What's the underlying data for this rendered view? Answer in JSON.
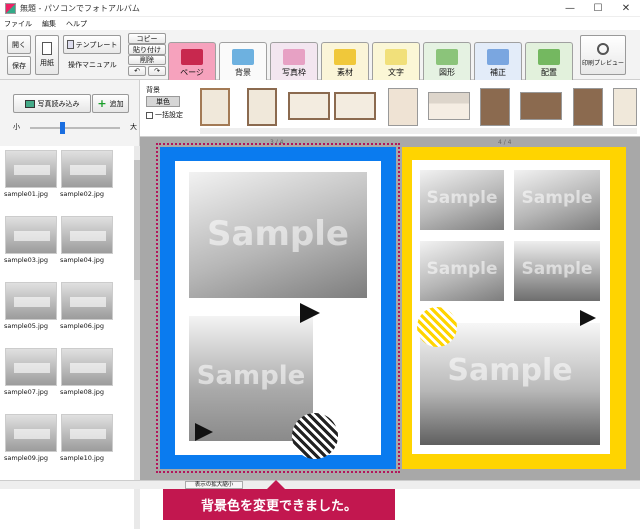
{
  "window": {
    "title": "無題 - パソコンでフォトアルバム",
    "min": "—",
    "max": "☐",
    "close": "✕"
  },
  "menu": [
    "ファイル",
    "編集",
    "ヘルプ"
  ],
  "toolbar": {
    "open": "開く",
    "save": "保存",
    "paper": "用紙",
    "template": "テンプレート",
    "manual": "操作マニュアル",
    "copy": "コピー",
    "paste": "貼り付け",
    "delete": "削除",
    "undo": "↶",
    "redo": "↷",
    "print_preview": "印刷プレビュー"
  },
  "tabs": [
    {
      "label": "ページ",
      "color": "#f08aa8"
    },
    {
      "label": "背景",
      "color": "#f5f5f5"
    },
    {
      "label": "写真枠",
      "color": "#f5f5f5"
    },
    {
      "label": "素材",
      "color": "#f5f5f5"
    },
    {
      "label": "文字",
      "color": "#f5f5f5"
    },
    {
      "label": "図形",
      "color": "#f5f5f5"
    },
    {
      "label": "補正",
      "color": "#f5f5f5"
    },
    {
      "label": "配置",
      "color": "#f5f5f5"
    }
  ],
  "bg_panel": {
    "heading": "背景",
    "solid": "単色",
    "bulk_setting": "一括設定"
  },
  "left": {
    "photo_import": "写真読み込み",
    "add": "追加",
    "zoom_small": "小",
    "zoom_large": "大",
    "files": [
      "sample01.jpg",
      "sample02.jpg",
      "sample03.jpg",
      "sample04.jpg",
      "sample05.jpg",
      "sample06.jpg",
      "sample07.jpg",
      "sample08.jpg",
      "sample09.jpg",
      "sample10.jpg"
    ]
  },
  "pages": {
    "left_label": "3 / 4",
    "right_label": "4 / 4",
    "watermark": "Sample"
  },
  "status": {
    "zoom_label": "表示の拡大縮小"
  },
  "banner": "背景色を変更できました。",
  "colors": {
    "left_bg": "#0a7bef",
    "right_bg": "#ffd400",
    "banner": "#c2174f"
  }
}
